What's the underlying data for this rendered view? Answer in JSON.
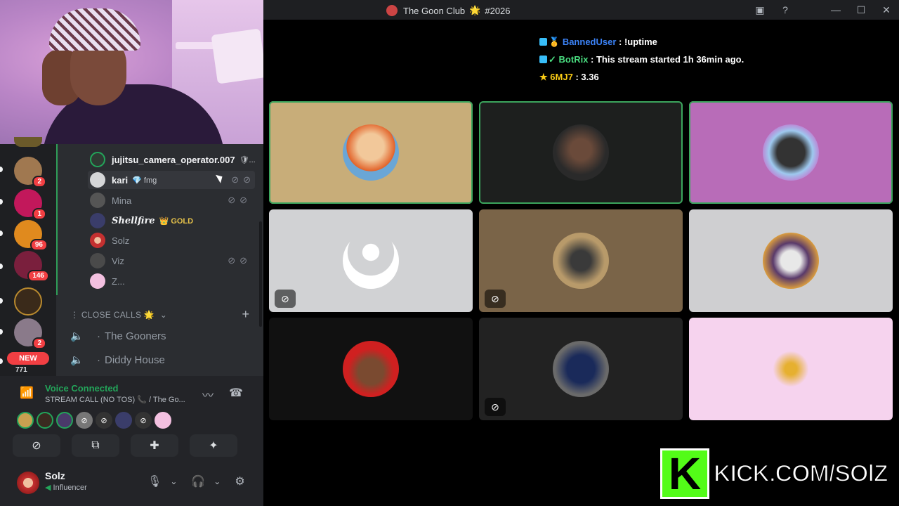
{
  "window": {
    "title": "The Goon Club",
    "title_emoji": "🌟",
    "title_suffix": "#2026"
  },
  "servers": [
    {
      "badge": "2"
    },
    {
      "badge": "1"
    },
    {
      "badge": "96"
    },
    {
      "badge": "146"
    },
    {
      "badge": ""
    },
    {
      "badge": "2"
    },
    {
      "badge": "771",
      "label": "NEW"
    }
  ],
  "voice_users": [
    {
      "name": "jujitsu_camera_operator.007",
      "suffix": "🛡...",
      "tag": ""
    },
    {
      "name": "kari",
      "tag": "💎 fmg"
    },
    {
      "name": "Mina",
      "tag": ""
    },
    {
      "name": "Shellfire",
      "tag": "👑 GOLD"
    },
    {
      "name": "Solz",
      "tag": ""
    },
    {
      "name": "Viz",
      "tag": ""
    },
    {
      "name": "Z...",
      "tag": ""
    }
  ],
  "category": {
    "label": "⋮ CLOSE CALLS 🌟",
    "chevron": "⌄",
    "add": "+"
  },
  "voice_channels": [
    {
      "name": "The Gooners"
    },
    {
      "name": "Diddy House"
    }
  ],
  "voice_panel": {
    "title": "Voice Connected",
    "subtitle": "STREAM CALL (NO TOS) 📞 / The Go..."
  },
  "user": {
    "name": "Solz",
    "status": "Influencer"
  },
  "chat": [
    {
      "user": "BannedUser",
      "message": ": !uptime"
    },
    {
      "user": "BotRix",
      "message": ": This stream started 1h 36min ago."
    },
    {
      "user": "6MJ7",
      "message": ": 3.36"
    }
  ],
  "watermark": {
    "k": "K",
    "url": "KICK.COM/SOlZ"
  },
  "colors": {
    "voice_green": "#23a55a",
    "kick_green": "#53fc18",
    "badge_red": "#f23f43"
  }
}
